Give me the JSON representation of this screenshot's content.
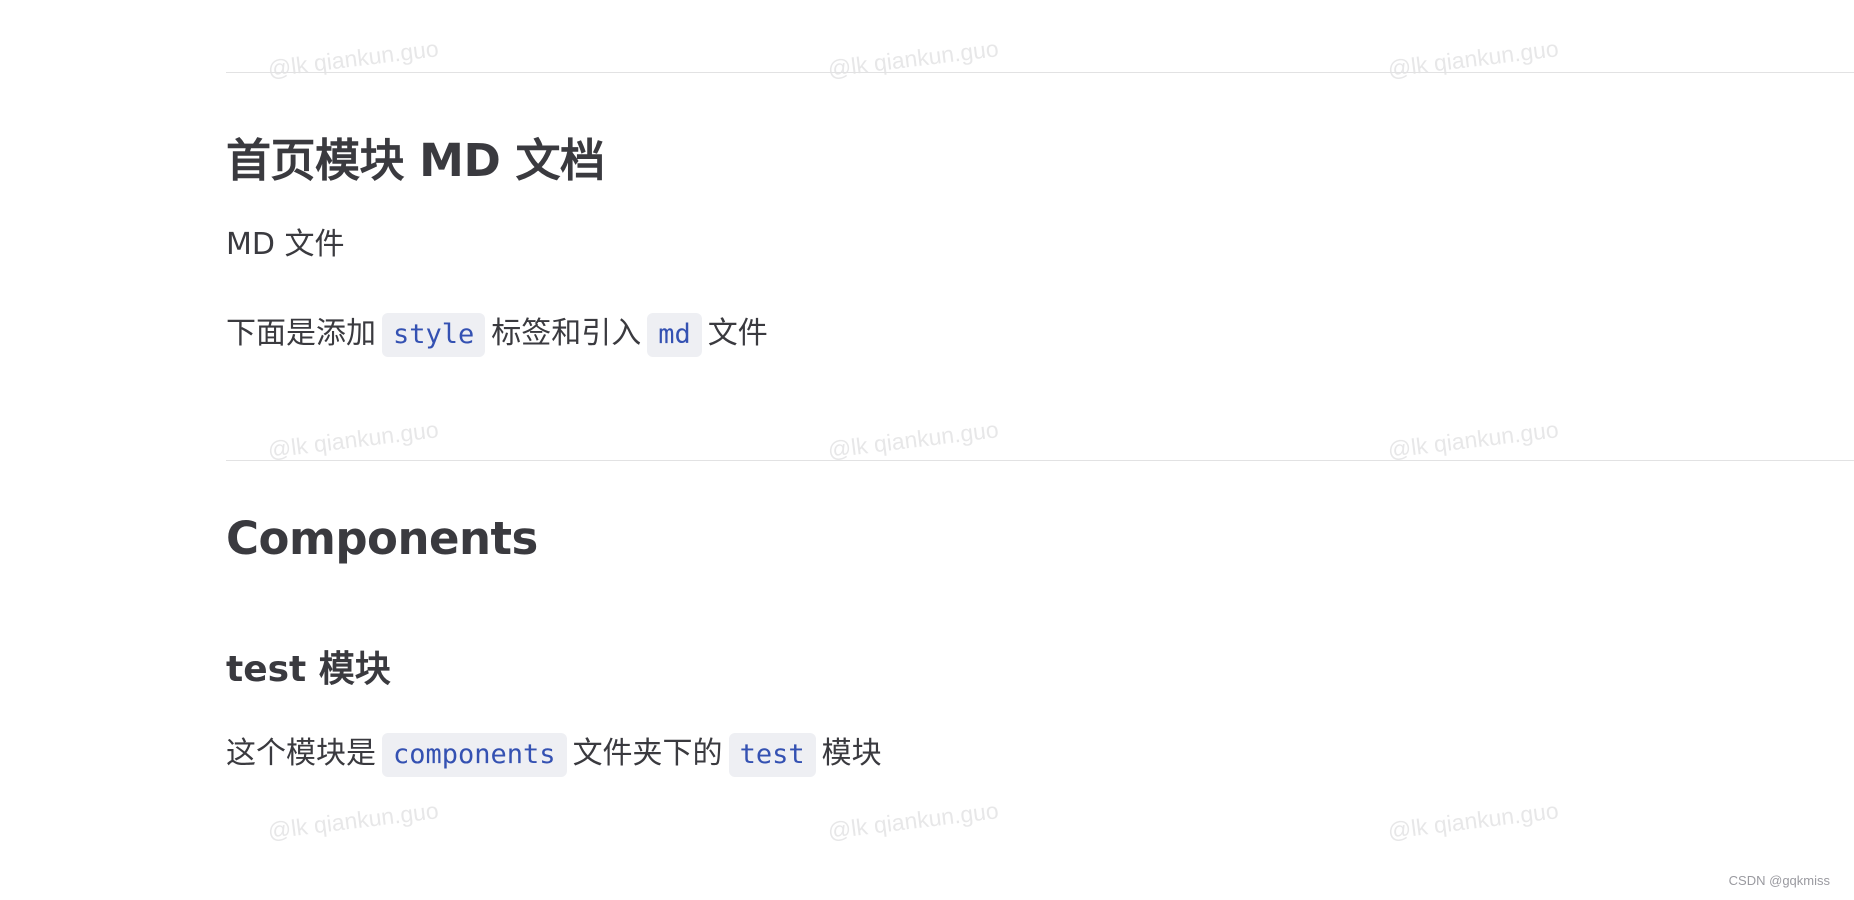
{
  "doc": {
    "section1": {
      "title": "首页模块 MD 文档",
      "para1": "MD 文件",
      "para2": {
        "pre": "下面是添加",
        "code1": "style",
        "mid": "标签和引入",
        "code2": "md",
        "post": "文件"
      }
    },
    "section2": {
      "title": "Components",
      "subsection": {
        "title": "test 模块",
        "para": {
          "pre": "这个模块是",
          "code1": "components",
          "mid": "文件夹下的",
          "code2": "test",
          "post": "模块"
        }
      }
    }
  },
  "watermark": {
    "text": "@lk qiankun.guo"
  },
  "credit": "CSDN @gqkmiss",
  "colors": {
    "text": "#3a3a3f",
    "code_text": "#3451b2",
    "code_bg": "#eeeff3",
    "divider": "#e2e2e3"
  }
}
